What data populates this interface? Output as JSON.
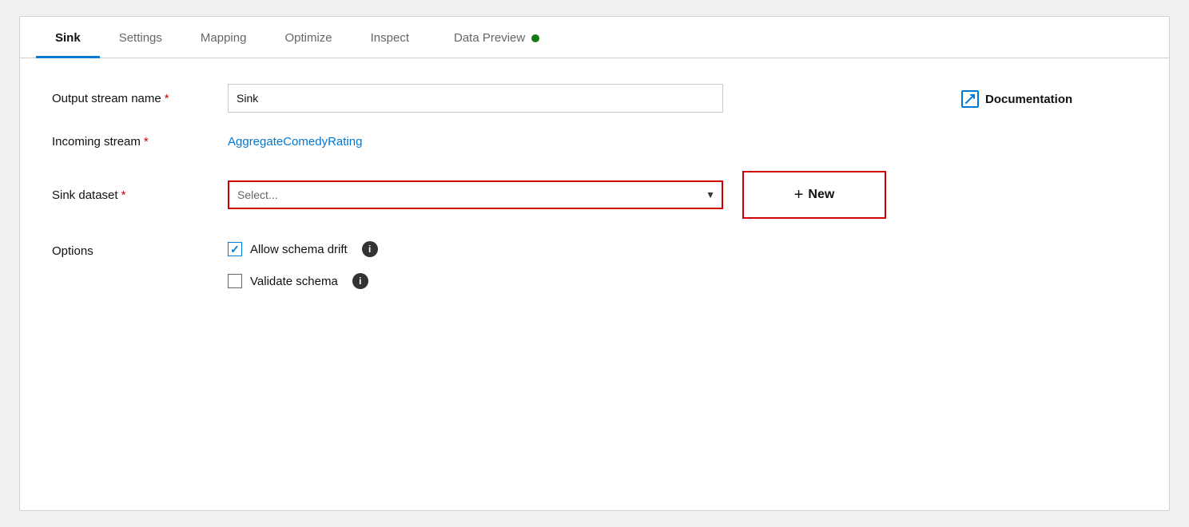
{
  "tabs": [
    {
      "id": "sink",
      "label": "Sink",
      "active": true
    },
    {
      "id": "settings",
      "label": "Settings",
      "active": false
    },
    {
      "id": "mapping",
      "label": "Mapping",
      "active": false
    },
    {
      "id": "optimize",
      "label": "Optimize",
      "active": false
    },
    {
      "id": "inspect",
      "label": "Inspect",
      "active": false
    },
    {
      "id": "data-preview",
      "label": "Data Preview",
      "active": false
    }
  ],
  "status_dot_color": "#107c10",
  "form": {
    "output_stream_name_label": "Output stream name",
    "output_stream_name_required": "*",
    "output_stream_name_value": "Sink",
    "incoming_stream_label": "Incoming stream",
    "incoming_stream_required": "*",
    "incoming_stream_link": "AggregateComedyRating",
    "sink_dataset_label": "Sink dataset",
    "sink_dataset_required": "*",
    "sink_dataset_placeholder": "Select...",
    "options_label": "Options",
    "allow_schema_drift_label": "Allow schema drift",
    "allow_schema_drift_checked": true,
    "validate_schema_label": "Validate schema",
    "validate_schema_checked": false
  },
  "buttons": {
    "new_label": "New",
    "new_plus": "+"
  },
  "documentation": {
    "label": "Documentation",
    "icon_symbol": "⤢"
  }
}
